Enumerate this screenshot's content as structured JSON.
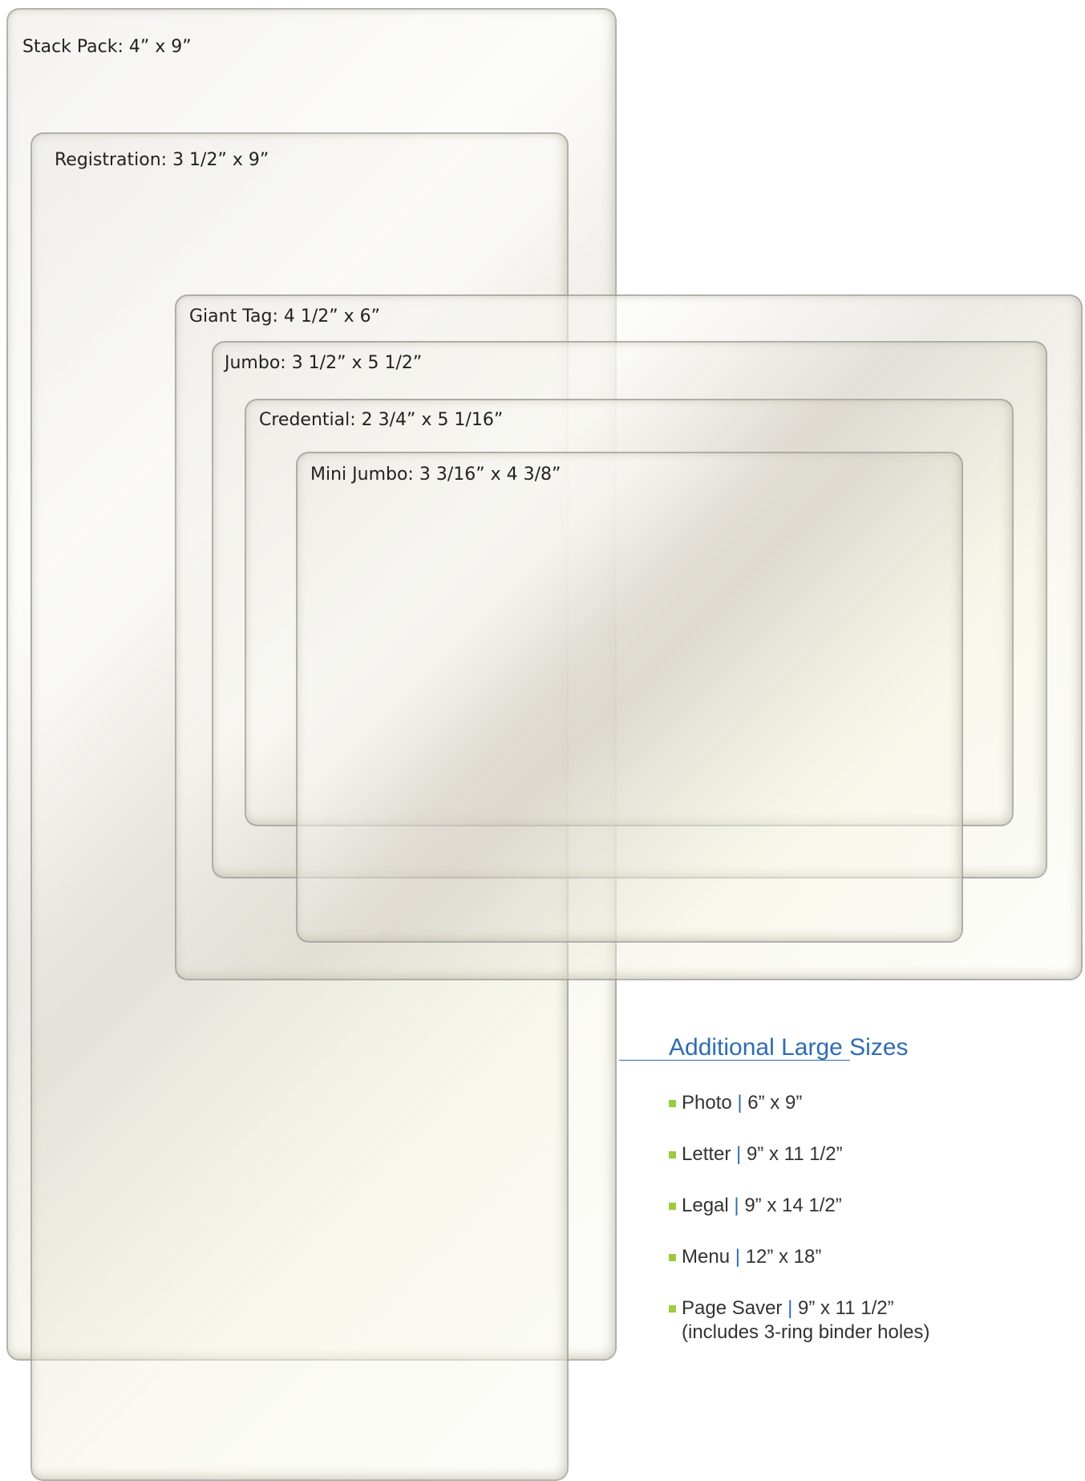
{
  "pouches": {
    "stack_pack": "Stack Pack: 4” x 9”",
    "registration": "Registration: 3 1/2” x 9”",
    "giant_tag": "Giant Tag: 4 1/2” x 6”",
    "jumbo": "Jumbo: 3 1/2” x 5 1/2”",
    "credential": "Credential: 2 3/4” x 5 1/16”",
    "mini_jumbo": "Mini Jumbo: 3 3/16” x 4 3/8”"
  },
  "additional_sizes": {
    "title": "Additional Large Sizes",
    "separator": "|",
    "items": [
      {
        "name": "Photo",
        "size": "6” x 9”"
      },
      {
        "name": "Letter",
        "size": "9” x 11 1/2”"
      },
      {
        "name": "Legal",
        "size": "9” x 14 1/2”"
      },
      {
        "name": "Menu",
        "size": "12” x 18”"
      },
      {
        "name": "Page Saver",
        "size": "9” x 11 1/2”",
        "note": "(includes 3-ring binder holes)"
      }
    ]
  },
  "colors": {
    "accent_blue": "#2f6cb3",
    "bullet_green": "#9ccc3c",
    "label_text": "#222222"
  }
}
